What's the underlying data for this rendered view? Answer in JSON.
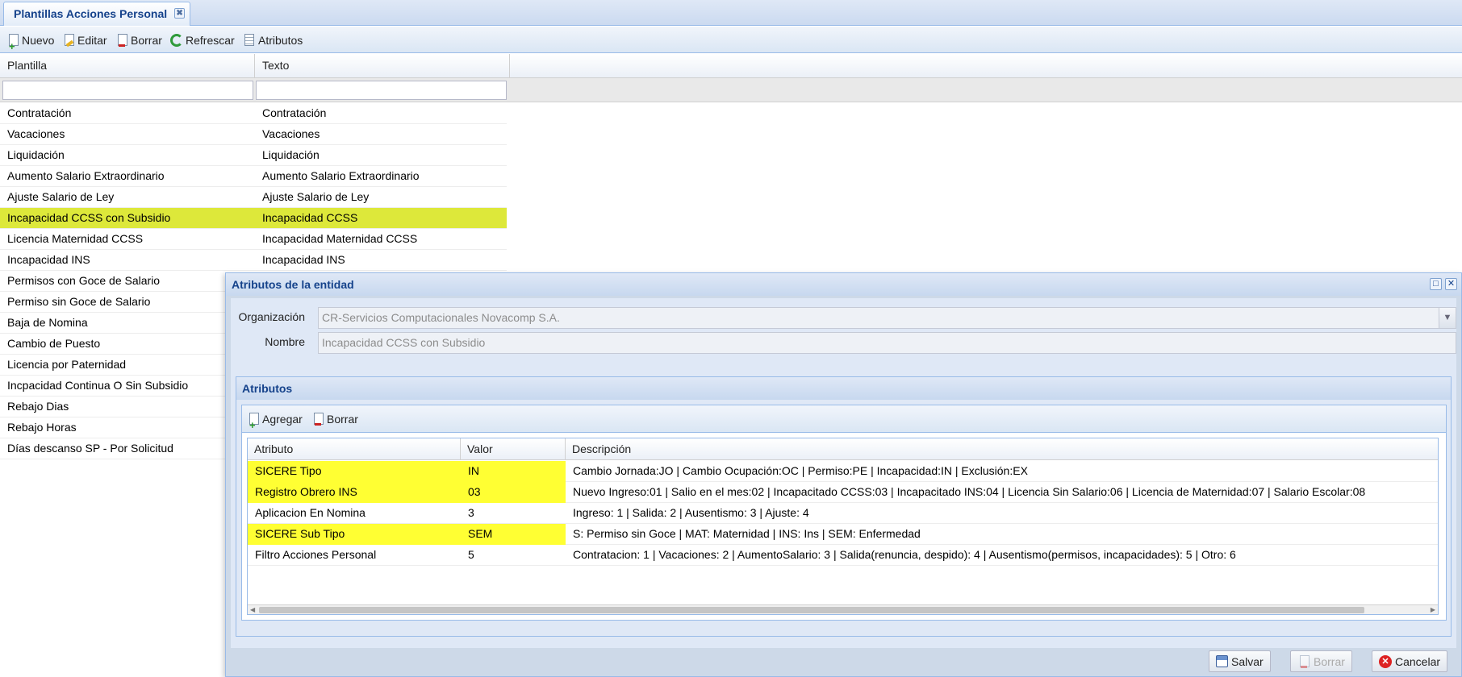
{
  "tab": {
    "title": "Plantillas Acciones Personal",
    "close_glyph": "✖"
  },
  "toolbar": {
    "nuevo": "Nuevo",
    "editar": "Editar",
    "borrar": "Borrar",
    "refrescar": "Refrescar",
    "atributos": "Atributos"
  },
  "grid": {
    "columns": [
      "Plantilla",
      "Texto"
    ],
    "filters": [
      "",
      ""
    ],
    "rows": [
      {
        "plantilla": "Contratación",
        "texto": "Contratación"
      },
      {
        "plantilla": "Vacaciones",
        "texto": "Vacaciones"
      },
      {
        "plantilla": "Liquidación",
        "texto": "Liquidación"
      },
      {
        "plantilla": "Aumento Salario Extraordinario",
        "texto": "Aumento Salario Extraordinario"
      },
      {
        "plantilla": "Ajuste Salario de Ley",
        "texto": "Ajuste Salario de Ley"
      },
      {
        "plantilla": "Incapacidad CCSS con Subsidio",
        "texto": "Incapacidad CCSS",
        "selected": true
      },
      {
        "plantilla": "Licencia Maternidad CCSS",
        "texto": "Incapacidad Maternidad CCSS"
      },
      {
        "plantilla": "Incapacidad INS",
        "texto": "Incapacidad INS"
      },
      {
        "plantilla": "Permisos con Goce de Salario",
        "texto": ""
      },
      {
        "plantilla": "Permiso sin Goce de Salario",
        "texto": ""
      },
      {
        "plantilla": "Baja de Nomina",
        "texto": ""
      },
      {
        "plantilla": "Cambio de Puesto",
        "texto": ""
      },
      {
        "plantilla": "Licencia por Paternidad",
        "texto": ""
      },
      {
        "plantilla": "Incpacidad Continua O Sin Subsidio",
        "texto": ""
      },
      {
        "plantilla": "Rebajo Dias",
        "texto": ""
      },
      {
        "plantilla": "Rebajo Horas",
        "texto": ""
      },
      {
        "plantilla": "Días descanso SP - Por Solicitud",
        "texto": ""
      }
    ]
  },
  "window": {
    "title": "Atributos de la entidad",
    "maximize_glyph": "□",
    "close_glyph": "✕",
    "organizacion_label": "Organización",
    "organizacion_value": "CR-Servicios Computacionales Novacomp S.A.",
    "nombre_label": "Nombre",
    "nombre_value": "Incapacidad CCSS con Subsidio",
    "panel_title": "Atributos",
    "agregar": "Agregar",
    "borrar": "Borrar",
    "columns": [
      "Atributo",
      "Valor",
      "Descripción"
    ],
    "rows": [
      {
        "atributo": "SICERE Tipo",
        "valor": "IN",
        "descripcion": "Cambio Jornada:JO | Cambio Ocupación:OC | Permiso:PE | Incapacidad:IN | Exclusión:EX",
        "highlight": true
      },
      {
        "atributo": "Registro Obrero INS",
        "valor": "03",
        "descripcion": "Nuevo Ingreso:01 | Salio en el mes:02 | Incapacitado CCSS:03 | Incapacitado INS:04 | Licencia Sin Salario:06 | Licencia de Maternidad:07 | Salario Escolar:08",
        "highlight": true
      },
      {
        "atributo": "Aplicacion En Nomina",
        "valor": "3",
        "descripcion": "Ingreso: 1 | Salida: 2 | Ausentismo: 3 | Ajuste: 4",
        "highlight": false
      },
      {
        "atributo": "SICERE Sub Tipo",
        "valor": "SEM",
        "descripcion": "S: Permiso sin Goce | MAT: Maternidad | INS: Ins | SEM: Enfermedad",
        "highlight": true
      },
      {
        "atributo": "Filtro Acciones Personal",
        "valor": "5",
        "descripcion": "Contratacion: 1 | Vacaciones: 2 | AumentoSalario: 3 | Salida(renuncia, despido): 4 | Ausentismo(permisos, incapacidades): 5 | Otro: 6",
        "highlight": false
      }
    ],
    "salvar": "Salvar",
    "borrar_btn": "Borrar",
    "cancelar": "Cancelar"
  },
  "colors": {
    "selection": "#dde83a",
    "highlight": "#ffff33",
    "title_text": "#15428b"
  }
}
